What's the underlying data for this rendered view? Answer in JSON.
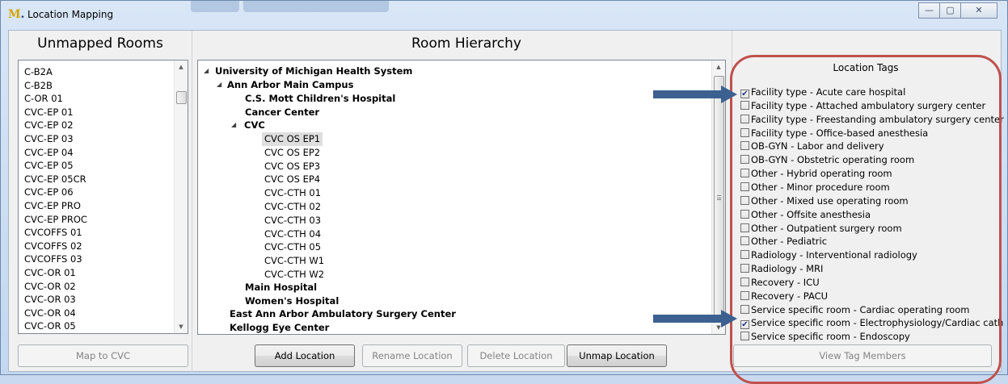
{
  "window": {
    "title": "Location Mapping",
    "icon": "michigan-m-icon",
    "controls": {
      "minimize": "minimize-icon",
      "maximize": "maximize-icon",
      "close": "close-icon"
    }
  },
  "unmapped": {
    "header": "Unmapped Rooms",
    "rooms": [
      "C-B2A",
      "C-B2B",
      "C-OR 01",
      "CVC-EP 01",
      "CVC-EP 02",
      "CVC-EP 03",
      "CVC-EP 04",
      "CVC-EP 05",
      "CVC-EP 05CR",
      "CVC-EP 06",
      "CVC-EP PRO",
      "CVC-EP PROC",
      "CVCOFFS 01",
      "CVCOFFS 02",
      "CVCOFFS 03",
      "CVC-OR 01",
      "CVC-OR 02",
      "CVC-OR 03",
      "CVC-OR 04",
      "CVC-OR 05"
    ],
    "map_button": "Map to CVC"
  },
  "hierarchy": {
    "header": "Room Hierarchy",
    "nodes": {
      "umhs": "University of Michigan Health System",
      "ann_arbor": "Ann Arbor Main Campus",
      "mott": "C.S. Mott Children's Hospital",
      "cancer": "Cancer Center",
      "cvc": "CVC",
      "cvc_rooms": [
        "CVC OS EP1",
        "CVC OS EP2",
        "CVC OS EP3",
        "CVC OS EP4",
        "CVC-CTH 01",
        "CVC-CTH 02",
        "CVC-CTH 03",
        "CVC-CTH 04",
        "CVC-CTH 05",
        "CVC-CTH W1",
        "CVC-CTH W2"
      ],
      "main_hospital": "Main Hospital",
      "womens": "Women's Hospital",
      "east_ann_arbor": "East Ann Arbor Ambulatory Surgery Center",
      "kellogg": "Kellogg Eye Center"
    },
    "selected": "CVC OS EP1",
    "buttons": {
      "add": "Add Location",
      "rename": "Rename Location",
      "delete": "Delete Location",
      "unmap": "Unmap Location"
    }
  },
  "tags": {
    "header": "Location Tags",
    "items": [
      {
        "label": "Facility type - Acute care hospital",
        "checked": true
      },
      {
        "label": "Facility type - Attached ambulatory surgery center",
        "checked": false
      },
      {
        "label": "Facility type - Freestanding ambulatory surgery center",
        "checked": false
      },
      {
        "label": "Facility type - Office-based anesthesia",
        "checked": false
      },
      {
        "label": "OB-GYN - Labor and delivery",
        "checked": false
      },
      {
        "label": "OB-GYN - Obstetric operating room",
        "checked": false
      },
      {
        "label": "Other - Hybrid operating room",
        "checked": false
      },
      {
        "label": "Other - Minor procedure room",
        "checked": false
      },
      {
        "label": "Other - Mixed use operating room",
        "checked": false
      },
      {
        "label": "Other - Offsite anesthesia",
        "checked": false
      },
      {
        "label": "Other - Outpatient surgery room",
        "checked": false
      },
      {
        "label": "Other - Pediatric",
        "checked": false
      },
      {
        "label": "Radiology - Interventional radiology",
        "checked": false
      },
      {
        "label": "Radiology - MRI",
        "checked": false
      },
      {
        "label": "Recovery - ICU",
        "checked": false
      },
      {
        "label": "Recovery - PACU",
        "checked": false
      },
      {
        "label": "Service specific room - Cardiac operating room",
        "checked": false
      },
      {
        "label": "Service specific room - Electrophysiology/Cardiac cath",
        "checked": true
      },
      {
        "label": "Service specific room - Endoscopy",
        "checked": false
      }
    ],
    "view_button": "View Tag Members"
  },
  "annotation": {
    "oval_color": "#c0504d",
    "arrow_color": "#3c6190"
  }
}
